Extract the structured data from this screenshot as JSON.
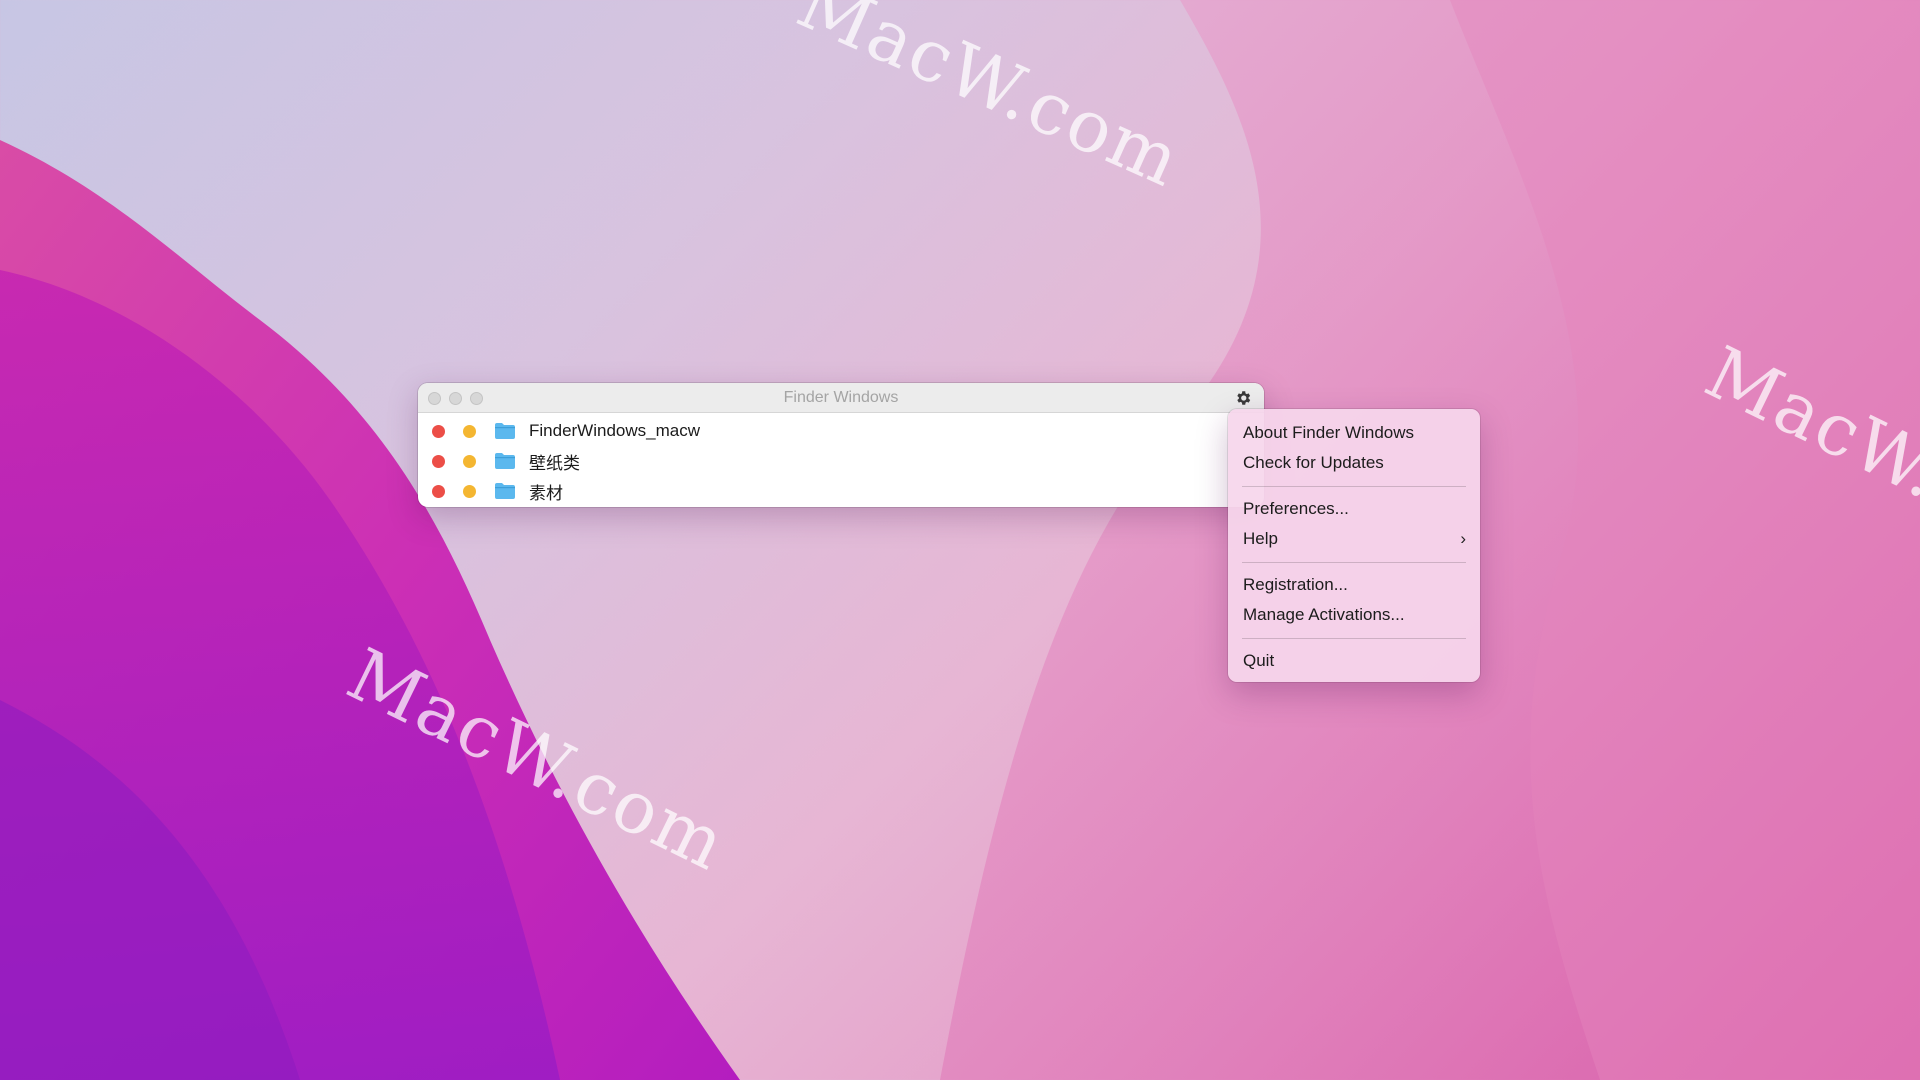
{
  "watermarks": [
    "MacW.com",
    "MacW.com",
    "MacW.com"
  ],
  "window": {
    "title": "Finder Windows",
    "items": [
      {
        "label": "FinderWindows_macw",
        "icon": "folder-icon"
      },
      {
        "label": "壁纸类",
        "icon": "folder-icon"
      },
      {
        "label": "素材",
        "icon": "folder-icon"
      }
    ],
    "settings_icon": "gear-icon"
  },
  "menu": {
    "about": "About Finder Windows",
    "updates": "Check for Updates",
    "preferences": "Preferences...",
    "help": "Help",
    "help_chevron": "›",
    "registration": "Registration...",
    "manage_activations": "Manage Activations...",
    "quit": "Quit"
  },
  "colors": {
    "close_dot": "#ec4e47",
    "minimize_dot": "#f4b631",
    "folder": "#5bb8ee"
  }
}
